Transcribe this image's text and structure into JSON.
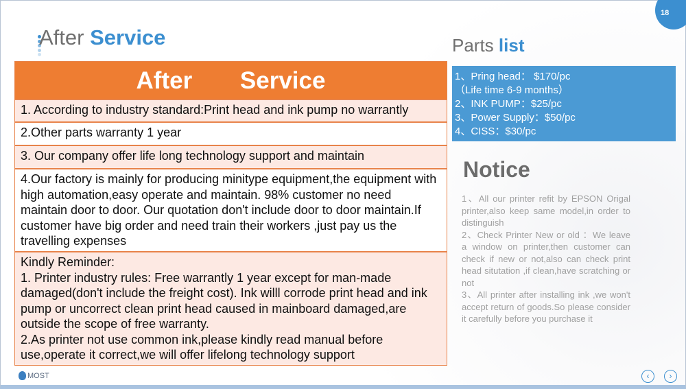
{
  "page_number": "18",
  "title": {
    "part1": "After",
    "part2": "Service"
  },
  "table": {
    "header": "After Service",
    "rows": [
      "1. According to industry standard:Print head and ink pump no  warrantly",
      "2.Other parts warranty 1 year",
      "3. Our company offer life long technology support and maintain",
      "4.Our factory is mainly for producing minitype equipment,the equipment with high automation,easy operate and maintain. 98% customer no need maintain door to door. Our quotation don't include door to door maintain.If customer have big order and need train their workers ,just pay us the travelling expenses"
    ],
    "reminder": [
      "Kindly Reminder:",
      "1. Printer industry rules: Free warrantly 1 year except for man-made damaged(don't include the freight cost). Ink willl corrode print head and ink pump or uncorrect clean print head caused in mainboard damaged,are outside the scope of free warranty.",
      "2.As printer not use common ink,please kindly read manual before use,operate it correct,we will offer lifelong technology support"
    ]
  },
  "parts": {
    "title1": "Parts",
    "title2": "list",
    "items": [
      "1、Pring head：  $170/pc",
      "（Life time 6-9 months）",
      "2、INK PUMP：$25/pc",
      "3、Power Supply：$50/pc",
      "4、CISS：$30/pc"
    ]
  },
  "notice": {
    "title": "Notice",
    "items": [
      "1、All our printer refit by EPSON Origal printer,also keep same model,in order to distinguish",
      "2、Check Printer New or old ：We leave a window on printer,then customer can check if new or not,also can check print head situtation ,if clean,have scratching or not",
      "3、All printer after installing ink ,we won't accept return of goods.So please consider it carefully before you purchase it"
    ]
  },
  "footer": {
    "logo": "MOST",
    "prev_icon": "chevron-left-circle",
    "next_icon": "chevron-right-circle"
  },
  "colors": {
    "accent_blue": "#3c8fd0",
    "orange": "#ee7d32",
    "row_pink": "#fde9e3"
  }
}
